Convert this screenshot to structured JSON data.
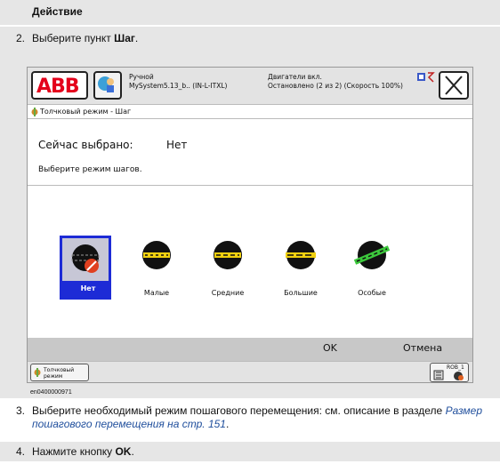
{
  "table_header": "Действие",
  "steps": [
    {
      "num": "2.",
      "text": "Выберите пункт "
    },
    {
      "num": "3.",
      "text": "Выберите необходимый режим пошагового перемещения: см. описание в разделе ",
      "link": "Размер пошагового перемещения на стр. 151",
      "tail": "."
    },
    {
      "num": "4.",
      "text": "Нажмите кнопку "
    }
  ],
  "step2_bold": "Шаг",
  "step2_tail": ".",
  "step4_bold": "OK",
  "step4_tail": ".",
  "figure_id": "en0400000971",
  "flexpendant": {
    "logo": "ABB",
    "status_left": [
      "Ручной",
      "MySystem5.13_b.. (IN-L-ITXL)"
    ],
    "status_right": [
      "Двигатели вкл.",
      "Остановлено (2 из 2) (Скорость 100%)"
    ],
    "window_title": "Толчковый режим - Шаг",
    "current_label": "Сейчас выбрано:",
    "current_value": "Нет",
    "prompt": "Выберите режим шагов.",
    "modes": [
      "Нет",
      "Малые",
      "Средние",
      "Большие",
      "Особые"
    ],
    "selected_mode": "Нет",
    "ok": "OK",
    "cancel": "Отмена",
    "taskbar_item": [
      "Толчковый",
      "режим"
    ],
    "rob": "ROB_1"
  },
  "colors": {
    "selection": "#1d2bd6",
    "abb_red": "#e4001b",
    "link": "#1f4e9c"
  }
}
